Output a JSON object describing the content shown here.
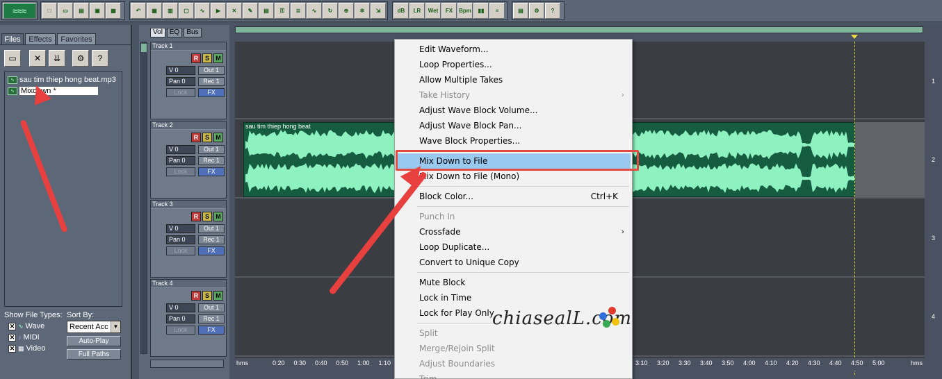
{
  "left_panel": {
    "tabs": [
      "Files",
      "Effects",
      "Favorites"
    ],
    "files": [
      "sau tim thiep hong beat.mp3",
      "Mixdown *"
    ],
    "show_file_types_label": "Show File Types:",
    "file_types": [
      "Wave",
      "MIDI",
      "Video"
    ],
    "sort_by_label": "Sort By:",
    "sort_value": "Recent Acc",
    "auto_play": "Auto-Play",
    "full_paths": "Full Paths"
  },
  "mixer_tabs": [
    "Vol",
    "EQ",
    "Bus"
  ],
  "tracks": [
    {
      "name": "Track 1",
      "vol": "V 0",
      "pan": "Pan 0",
      "out": "Out 1",
      "rec": "Rec 1",
      "lock": "Lock",
      "fx": "FX",
      "num": "1"
    },
    {
      "name": "Track 2",
      "vol": "V 0",
      "pan": "Pan 0",
      "out": "Out 1",
      "rec": "Rec 1",
      "lock": "Lock",
      "fx": "FX",
      "num": "2"
    },
    {
      "name": "Track 3",
      "vol": "V 0",
      "pan": "Pan 0",
      "out": "Out 1",
      "rec": "Rec 1",
      "lock": "Lock",
      "fx": "FX",
      "num": "3"
    },
    {
      "name": "Track 4",
      "vol": "V 0",
      "pan": "Pan 0",
      "out": "Out 1",
      "rec": "Rec 1",
      "lock": "Lock",
      "fx": "FX",
      "num": "4"
    }
  ],
  "track_buttons": {
    "r": "R",
    "s": "S",
    "m": "M"
  },
  "wave_block_title": "sau tim thiep hong beat",
  "ruler": {
    "left_label": "hms",
    "right_label": "hms",
    "ticks_left": [
      "0:20",
      "0:30",
      "0:40",
      "0:50",
      "1:00",
      "1:10"
    ],
    "ticks_right": [
      "3:10",
      "3:20",
      "3:30",
      "3:40",
      "3:50",
      "4:00",
      "4:10",
      "4:20",
      "4:30",
      "4:40",
      "4:50",
      "5:00"
    ]
  },
  "context_menu": {
    "items": [
      {
        "label": "Edit Waveform...",
        "state": "enabled"
      },
      {
        "label": "Loop Properties...",
        "state": "enabled"
      },
      {
        "label": "Allow Multiple Takes",
        "state": "enabled"
      },
      {
        "label": "Take History",
        "state": "disabled",
        "submenu": true
      },
      {
        "label": "Adjust Wave Block Volume...",
        "state": "enabled"
      },
      {
        "label": "Adjust Wave Block Pan...",
        "state": "enabled"
      },
      {
        "label": "Wave Block Properties...",
        "state": "enabled"
      },
      {
        "label": "Mix Down to File",
        "state": "highlighted"
      },
      {
        "label": "Mix Down to File (Mono)",
        "state": "enabled"
      },
      {
        "label": "Block Color...",
        "state": "enabled",
        "shortcut": "Ctrl+K"
      },
      {
        "label": "Punch In",
        "state": "disabled"
      },
      {
        "label": "Crossfade",
        "state": "enabled",
        "submenu": true
      },
      {
        "label": "Loop Duplicate...",
        "state": "enabled"
      },
      {
        "label": "Convert to Unique Copy",
        "state": "enabled"
      },
      {
        "label": "Mute Block",
        "state": "enabled"
      },
      {
        "label": "Lock in Time",
        "state": "enabled"
      },
      {
        "label": "Lock for Play Only",
        "state": "enabled"
      },
      {
        "label": "Split",
        "state": "disabled"
      },
      {
        "label": "Merge/Rejoin Split",
        "state": "disabled"
      },
      {
        "label": "Adjust Boundaries",
        "state": "disabled"
      },
      {
        "label": "Trim",
        "state": "disabled"
      }
    ]
  },
  "watermark": "chiasealL.com",
  "colors": {
    "wave": "#8ef2c0",
    "wave_bg": "#155c40",
    "highlight": "#99c9ef",
    "annotation": "#e24b42"
  }
}
